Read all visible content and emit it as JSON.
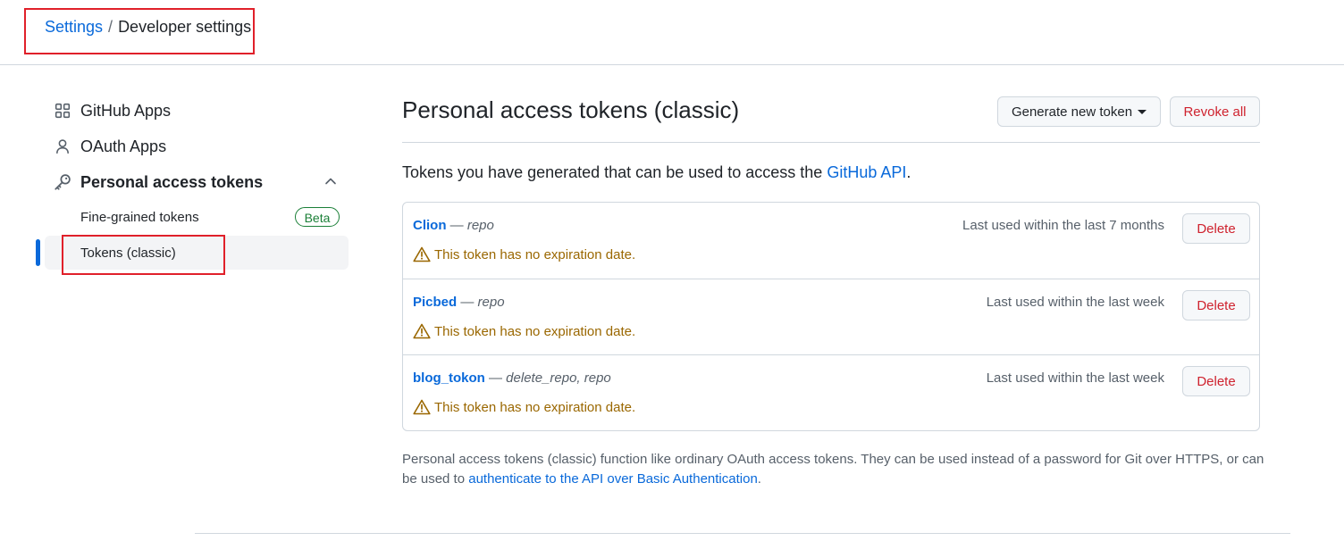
{
  "breadcrumb": {
    "root": "Settings",
    "separator": "/",
    "current": "Developer settings"
  },
  "sidebar": {
    "items": [
      {
        "label": "GitHub Apps",
        "icon": "apps-icon"
      },
      {
        "label": "OAuth Apps",
        "icon": "person-icon"
      },
      {
        "label": "Personal access tokens",
        "icon": "key-icon"
      }
    ],
    "sub_items": [
      {
        "label": "Fine-grained tokens",
        "badge": "Beta"
      },
      {
        "label": "Tokens (classic)"
      }
    ]
  },
  "main": {
    "title": "Personal access tokens (classic)",
    "generate_label": "Generate new token",
    "revoke_label": "Revoke all",
    "description_prefix": "Tokens you have generated that can be used to access the ",
    "description_link": "GitHub API",
    "description_suffix": "."
  },
  "tokens": [
    {
      "name": "Clion",
      "dash": " — ",
      "scopes": "repo",
      "last_used": "Last used within the last 7 months",
      "warning": "This token has no expiration date.",
      "delete_label": "Delete"
    },
    {
      "name": "Picbed",
      "dash": " — ",
      "scopes": "repo",
      "last_used": "Last used within the last week",
      "warning": "This token has no expiration date.",
      "delete_label": "Delete"
    },
    {
      "name": "blog_tokon",
      "dash": " — ",
      "scopes": "delete_repo, repo",
      "last_used": "Last used within the last week",
      "warning": "This token has no expiration date.",
      "delete_label": "Delete"
    }
  ],
  "footer": {
    "text": "Personal access tokens (classic) function like ordinary OAuth access tokens. They can be used instead of a password for Git over HTTPS, or can be used to ",
    "link": "authenticate to the API over Basic Authentication",
    "suffix": "."
  },
  "colors": {
    "link": "#0969da",
    "danger": "#cf222e",
    "warning": "#9a6700",
    "success": "#1a7f37",
    "annotation": "#e0202a"
  }
}
